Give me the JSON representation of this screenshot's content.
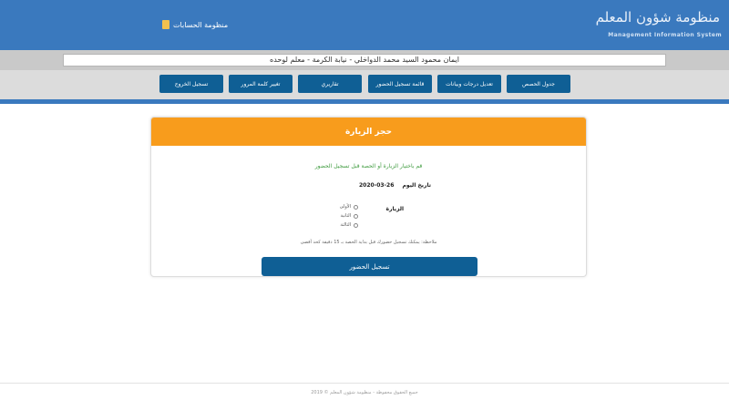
{
  "header": {
    "title": "منظومة شؤون المعلم",
    "subtitle": "Management Information System",
    "brand_link": "منظومة الحسابات"
  },
  "userbar": {
    "text": "ايمان محمود السيد محمد الدواخلي - نيابة الكرمة - معلم لوحده"
  },
  "nav": {
    "items": [
      {
        "label": "تسجيل الخروج"
      },
      {
        "label": "تغيير كلمة المرور"
      },
      {
        "label": "تقاريري"
      },
      {
        "label": "قائمة تسجيل الحضور"
      },
      {
        "label": "تعديل درجات وبيانات"
      },
      {
        "label": "جدول الحصص"
      }
    ]
  },
  "card": {
    "title": "حجز الزيارة",
    "info": "قم باختيار الزيارة أو الحصة قبل تسجيل الحضور",
    "date_label": "تاريخ اليوم",
    "date_value": "2020-03-26",
    "period_label": "الزيارة",
    "options": [
      "الأولى",
      "الثانية",
      "الثالثة"
    ],
    "note": "ملاحظة: يمكنك تسجيل حضورك قبل بداية الحصة بـ 15 دقيقة كحد أقصى",
    "submit": "تسجيل الحضور"
  },
  "footer": {
    "text": "جميع الحقوق محفوظة - منظومة شؤون المعلم © 2019"
  }
}
